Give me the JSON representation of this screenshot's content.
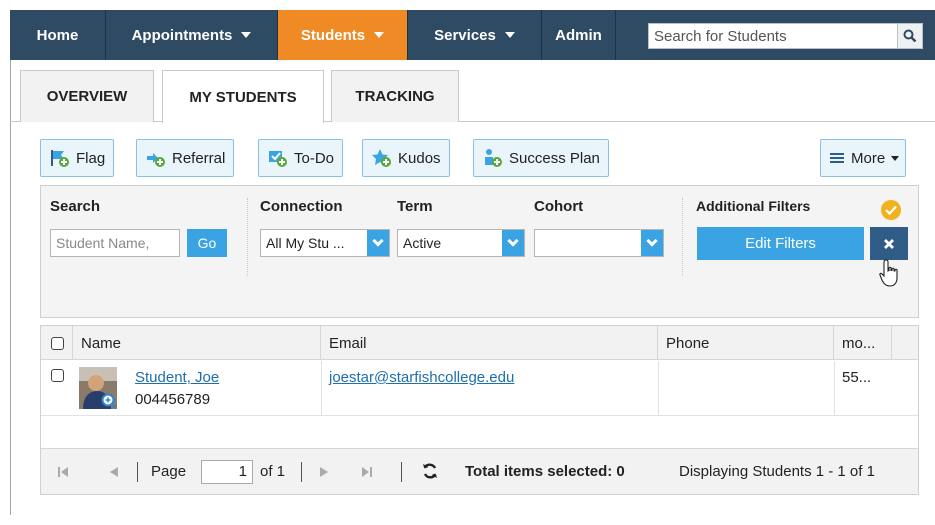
{
  "nav": {
    "items": [
      {
        "label": "Home",
        "caret": false
      },
      {
        "label": "Appointments",
        "caret": true
      },
      {
        "label": "Students",
        "caret": true
      },
      {
        "label": "Services",
        "caret": true
      },
      {
        "label": "Admin",
        "caret": false
      }
    ],
    "active": "Students",
    "search_placeholder": "Search for Students",
    "search_icon": "search-icon"
  },
  "tabs": [
    {
      "label": "OVERVIEW",
      "active": false
    },
    {
      "label": "MY STUDENTS",
      "active": true
    },
    {
      "label": "TRACKING",
      "active": false
    }
  ],
  "actions": {
    "flag": "Flag",
    "referral": "Referral",
    "todo": "To-Do",
    "kudos": "Kudos",
    "success_plan": "Success Plan",
    "more": "More"
  },
  "filters": {
    "search_label": "Search",
    "search_placeholder": "Student Name,",
    "go": "Go",
    "connection_label": "Connection",
    "connection_value": "All My Stu ...",
    "term_label": "Term",
    "term_value": "Active",
    "cohort_label": "Cohort",
    "cohort_value": "",
    "additional_label": "Additional Filters",
    "edit_filters": "Edit Filters",
    "clear_icon": "close-icon"
  },
  "table": {
    "headers": {
      "name": "Name",
      "email": "Email",
      "phone": "Phone",
      "more": "mo..."
    },
    "rows": [
      {
        "name": "Student, Joe",
        "id": "004456789",
        "email": "joestar@starfishcollege.edu",
        "phone": "",
        "more": "55..."
      }
    ]
  },
  "pager": {
    "page_label": "Page",
    "page_value": "1",
    "of_label": "of 1",
    "selected": "Total items selected: 0",
    "displaying": "Displaying Students 1 - 1 of 1"
  },
  "colors": {
    "nav_bg": "#2f4a63",
    "active_orange": "#f08a24",
    "accent_blue": "#3aa3e3",
    "dark_blue": "#2f5d87",
    "check_yellow": "#f0b21e"
  }
}
